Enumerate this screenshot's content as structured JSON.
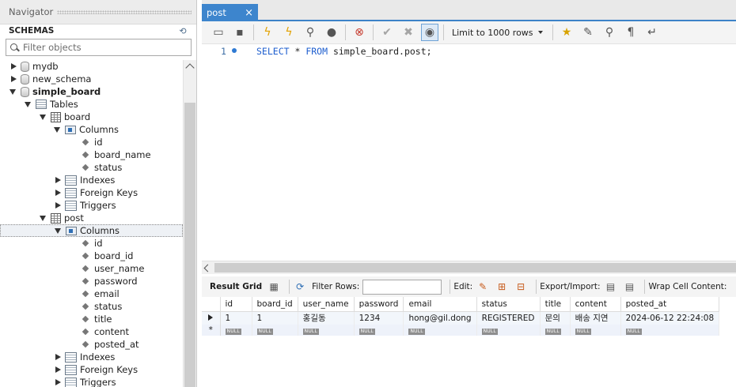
{
  "navigator": {
    "title": "Navigator",
    "schemas_label": "SCHEMAS",
    "filter_placeholder": "Filter objects",
    "tree": {
      "mydb": "mydb",
      "new_schema": "new_schema",
      "simple_board": "simple_board",
      "tables": "Tables",
      "board": "board",
      "board_columns": "Columns",
      "board_cols": [
        "id",
        "board_name",
        "status"
      ],
      "board_indexes": "Indexes",
      "board_fks": "Foreign Keys",
      "board_triggers": "Triggers",
      "post": "post",
      "post_columns": "Columns",
      "post_cols": [
        "id",
        "board_id",
        "user_name",
        "password",
        "email",
        "status",
        "title",
        "content",
        "posted_at"
      ],
      "post_indexes": "Indexes",
      "post_fks": "Foreign Keys",
      "post_triggers": "Triggers"
    }
  },
  "editor": {
    "tab_label": "post",
    "tab_close": "×",
    "limit_label": "Limit to 1000 rows",
    "line_number": "1",
    "sql": {
      "kw1": "SELECT",
      "mid1": " * ",
      "kw2": "FROM",
      "rest": " simple_board.post;"
    }
  },
  "results": {
    "result_grid": "Result Grid",
    "filter_rows": "Filter Rows:",
    "edit": "Edit:",
    "export_import": "Export/Import:",
    "wrap_cell": "Wrap Cell Content:",
    "columns": [
      "id",
      "board_id",
      "user_name",
      "password",
      "email",
      "status",
      "title",
      "content",
      "posted_at"
    ],
    "row": [
      "1",
      "1",
      "홍길동",
      "1234",
      "hong@gil.dong",
      "REGISTERED",
      "문의",
      "배송 지연",
      "2024-06-12 22:24:08"
    ],
    "null_label": "NULL",
    "new_row_marker": "*"
  },
  "icons": {
    "accent": "#3d85cd"
  }
}
